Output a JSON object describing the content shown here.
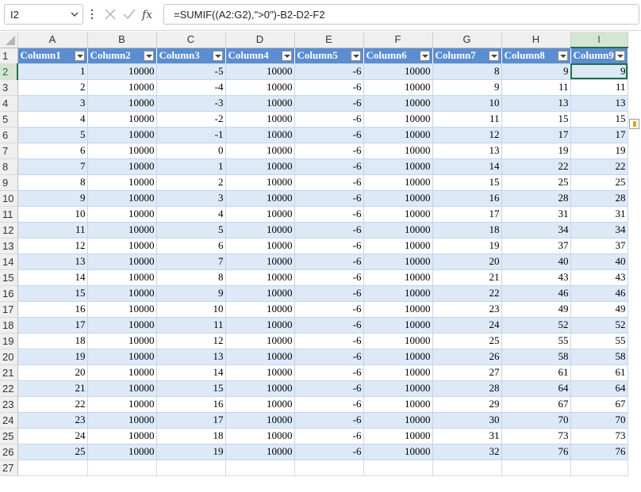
{
  "namebox": {
    "value": "I2"
  },
  "formula_bar": {
    "formula": "=SUMIF((A2:G2),\">0\")-B2-D2-F2"
  },
  "icons": {
    "cancel": "close-icon",
    "enter": "check-icon",
    "function": "fx-icon"
  },
  "colors": {
    "header_fill": "#5b8dd1",
    "band_fill": "#dde9f7",
    "selection": "#217346"
  },
  "selected_cell": "I2",
  "column_letters": [
    "A",
    "B",
    "C",
    "D",
    "E",
    "F",
    "G",
    "H",
    "I"
  ],
  "table_headers": [
    "Column1",
    "Column2",
    "Column3",
    "Column4",
    "Column5",
    "Column6",
    "Column7",
    "Column8",
    "Column9"
  ],
  "rows": [
    [
      "1",
      "10000",
      "-5",
      "10000",
      "-6",
      "10000",
      "8",
      "9",
      "9"
    ],
    [
      "2",
      "10000",
      "-4",
      "10000",
      "-6",
      "10000",
      "9",
      "11",
      "11"
    ],
    [
      "3",
      "10000",
      "-3",
      "10000",
      "-6",
      "10000",
      "10",
      "13",
      "13"
    ],
    [
      "4",
      "10000",
      "-2",
      "10000",
      "-6",
      "10000",
      "11",
      "15",
      "15"
    ],
    [
      "5",
      "10000",
      "-1",
      "10000",
      "-6",
      "10000",
      "12",
      "17",
      "17"
    ],
    [
      "6",
      "10000",
      "0",
      "10000",
      "-6",
      "10000",
      "13",
      "19",
      "19"
    ],
    [
      "7",
      "10000",
      "1",
      "10000",
      "-6",
      "10000",
      "14",
      "22",
      "22"
    ],
    [
      "8",
      "10000",
      "2",
      "10000",
      "-6",
      "10000",
      "15",
      "25",
      "25"
    ],
    [
      "9",
      "10000",
      "3",
      "10000",
      "-6",
      "10000",
      "16",
      "28",
      "28"
    ],
    [
      "10",
      "10000",
      "4",
      "10000",
      "-6",
      "10000",
      "17",
      "31",
      "31"
    ],
    [
      "11",
      "10000",
      "5",
      "10000",
      "-6",
      "10000",
      "18",
      "34",
      "34"
    ],
    [
      "12",
      "10000",
      "6",
      "10000",
      "-6",
      "10000",
      "19",
      "37",
      "37"
    ],
    [
      "13",
      "10000",
      "7",
      "10000",
      "-6",
      "10000",
      "20",
      "40",
      "40"
    ],
    [
      "14",
      "10000",
      "8",
      "10000",
      "-6",
      "10000",
      "21",
      "43",
      "43"
    ],
    [
      "15",
      "10000",
      "9",
      "10000",
      "-6",
      "10000",
      "22",
      "46",
      "46"
    ],
    [
      "16",
      "10000",
      "10",
      "10000",
      "-6",
      "10000",
      "23",
      "49",
      "49"
    ],
    [
      "17",
      "10000",
      "11",
      "10000",
      "-6",
      "10000",
      "24",
      "52",
      "52"
    ],
    [
      "18",
      "10000",
      "12",
      "10000",
      "-6",
      "10000",
      "25",
      "55",
      "55"
    ],
    [
      "19",
      "10000",
      "13",
      "10000",
      "-6",
      "10000",
      "26",
      "58",
      "58"
    ],
    [
      "20",
      "10000",
      "14",
      "10000",
      "-6",
      "10000",
      "27",
      "61",
      "61"
    ],
    [
      "21",
      "10000",
      "15",
      "10000",
      "-6",
      "10000",
      "28",
      "64",
      "64"
    ],
    [
      "22",
      "10000",
      "16",
      "10000",
      "-6",
      "10000",
      "29",
      "67",
      "67"
    ],
    [
      "23",
      "10000",
      "17",
      "10000",
      "-6",
      "10000",
      "30",
      "70",
      "70"
    ],
    [
      "24",
      "10000",
      "18",
      "10000",
      "-6",
      "10000",
      "31",
      "73",
      "73"
    ],
    [
      "25",
      "10000",
      "19",
      "10000",
      "-6",
      "10000",
      "32",
      "76",
      "76"
    ]
  ],
  "empty_row_numbers": [
    "27"
  ]
}
